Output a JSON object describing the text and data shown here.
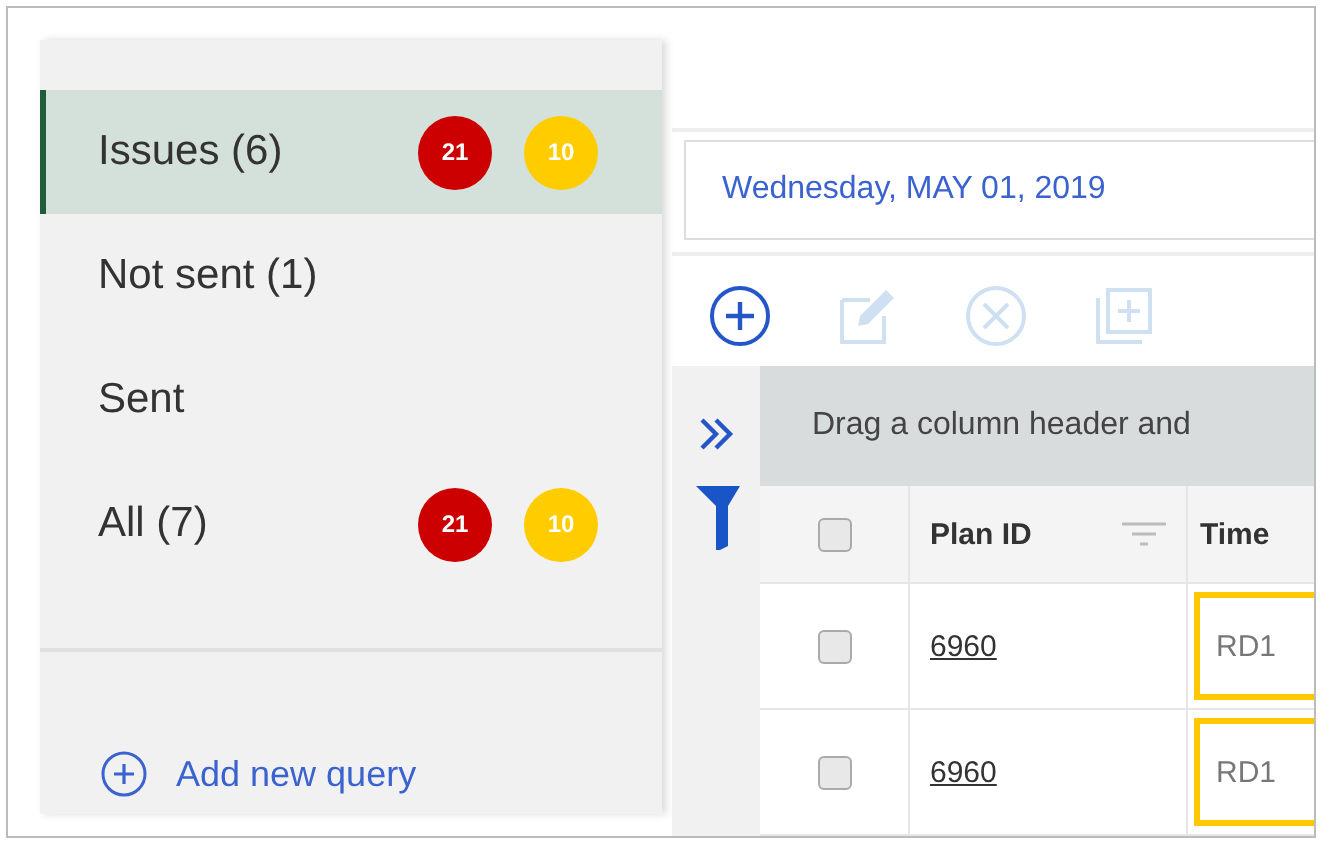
{
  "sidebar": {
    "items": [
      {
        "label": "Issues (6)",
        "selected": true,
        "badges": [
          {
            "text": "21",
            "color": "#cc0000"
          },
          {
            "text": "10",
            "color": "#ffcc00"
          }
        ]
      },
      {
        "label": "Not sent (1)",
        "selected": false
      },
      {
        "label": "Sent",
        "selected": false
      },
      {
        "label": "All (7)",
        "selected": false,
        "badges": [
          {
            "text": "21",
            "color": "#cc0000"
          },
          {
            "text": "10",
            "color": "#ffcc00"
          }
        ]
      }
    ],
    "add_query": "Add new query"
  },
  "date_field": {
    "value": "Wednesday, MAY 01, 2019"
  },
  "toolbar": [
    {
      "kind": "add",
      "disabled": false
    },
    {
      "kind": "edit",
      "disabled": true
    },
    {
      "kind": "delete",
      "disabled": true
    },
    {
      "kind": "copy",
      "disabled": true
    }
  ],
  "grid": {
    "select_all_checked": false,
    "group_hint": "Drag a column header and",
    "columns": [
      "Plan ID",
      "Time"
    ],
    "rows": [
      {
        "checked": false,
        "plan_id": "6960",
        "time": "RD1",
        "highlighted": true
      },
      {
        "checked": false,
        "plan_id": "6960",
        "time": "RD1",
        "highlighted": true
      }
    ]
  }
}
